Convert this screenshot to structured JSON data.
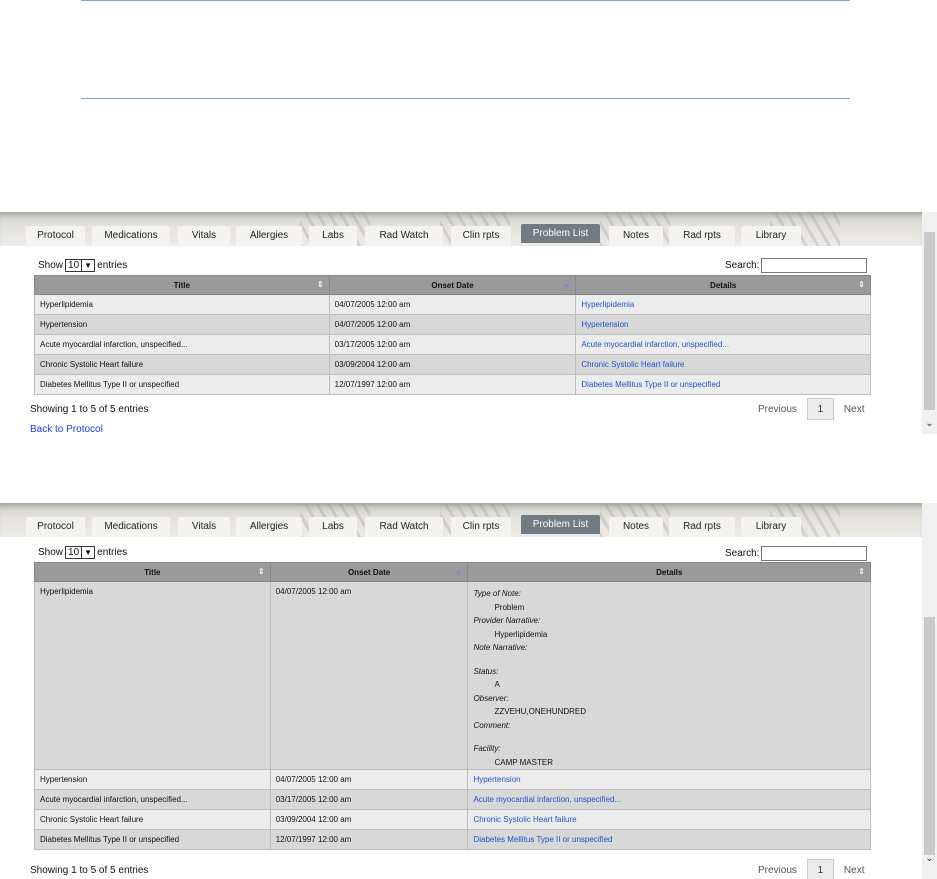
{
  "tabs": [
    "Protocol",
    "Medications",
    "Vitals",
    "Allergies",
    "Labs",
    "Rad Watch",
    "Clin rpts",
    "Problem List",
    "Notes",
    "Rad rpts",
    "Library"
  ],
  "active_tab": "Problem List",
  "controls": {
    "show_label": "Show",
    "entries_value": "10",
    "entries_label": "entries",
    "search_label": "Search:",
    "search_value": ""
  },
  "columns": [
    "Title",
    "Onset Date",
    "Details"
  ],
  "rows": [
    {
      "title": "Hyperlipidemia",
      "onset": "04/07/2005 12:00 am",
      "details": "Hyperlipidemia"
    },
    {
      "title": "Hypertension",
      "onset": "04/07/2005 12:00 am",
      "details": "Hypertension"
    },
    {
      "title": "Acute myocardial infarction, unspecified...",
      "onset": "03/17/2005 12:00 am",
      "details": "Acute myocardial infarction, unspecified..."
    },
    {
      "title": "Chronic Systolic Heart failure",
      "onset": "03/09/2004 12:00 am",
      "details": "Chronic Systolic Heart failure"
    },
    {
      "title": "Diabetes Mellitus Type II or unspecified",
      "onset": "12/07/1997 12:00 am",
      "details": "Diabetes Mellitus Type II or unspecified"
    }
  ],
  "expanded_details": {
    "type_label": "Type of Note:",
    "type_value": "Problem",
    "narrative_label": "Provider Narrative:",
    "narrative_value": "Hyperlipidemia",
    "note_narrative_label": "Note Narrative:",
    "status_label": "Status:",
    "status_value": "A",
    "observer_label": "Observer:",
    "observer_value": "ZZVEHU,ONEHUNDRED",
    "comment_label": "Comment:",
    "facility_label": "Facility:",
    "facility_value": "CAMP MASTER"
  },
  "footer": {
    "info": "Showing 1 to 5 of 5 entries",
    "previous": "Previous",
    "page": "1",
    "next": "Next",
    "back_link": "Back to Protocol"
  },
  "icons": {
    "sort_both": "sort-icon",
    "sort_desc": "sort-desc-icon",
    "dropdown": "chevron-down-icon",
    "scroll_down": "scroll-down-icon"
  }
}
